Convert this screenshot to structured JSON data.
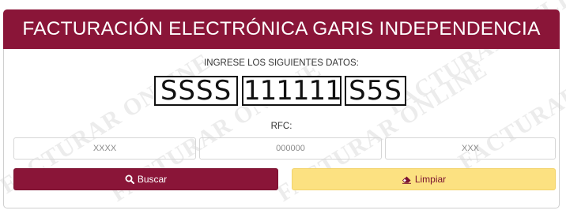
{
  "header": {
    "title": "FACTURACIÓN ELECTRÓNICA GARIS INDEPENDENCIA"
  },
  "form": {
    "instruction": "INGRESE LOS SIGUIENTES DATOS:",
    "captcha": [
      "SSSS",
      "111111",
      "S5S"
    ],
    "rfc_label": "RFC:",
    "fields": [
      {
        "placeholder": "XXXX"
      },
      {
        "placeholder": "000000"
      },
      {
        "placeholder": "XXX"
      }
    ],
    "buttons": {
      "search_label": "Buscar",
      "clear_label": "Limpiar"
    }
  },
  "watermark": {
    "text": "FACTURAR ONLINE"
  },
  "colors": {
    "brand": "#8a1538",
    "clear_button": "#fce181"
  },
  "icons": {
    "search": "search-icon",
    "clear": "eraser-icon"
  }
}
